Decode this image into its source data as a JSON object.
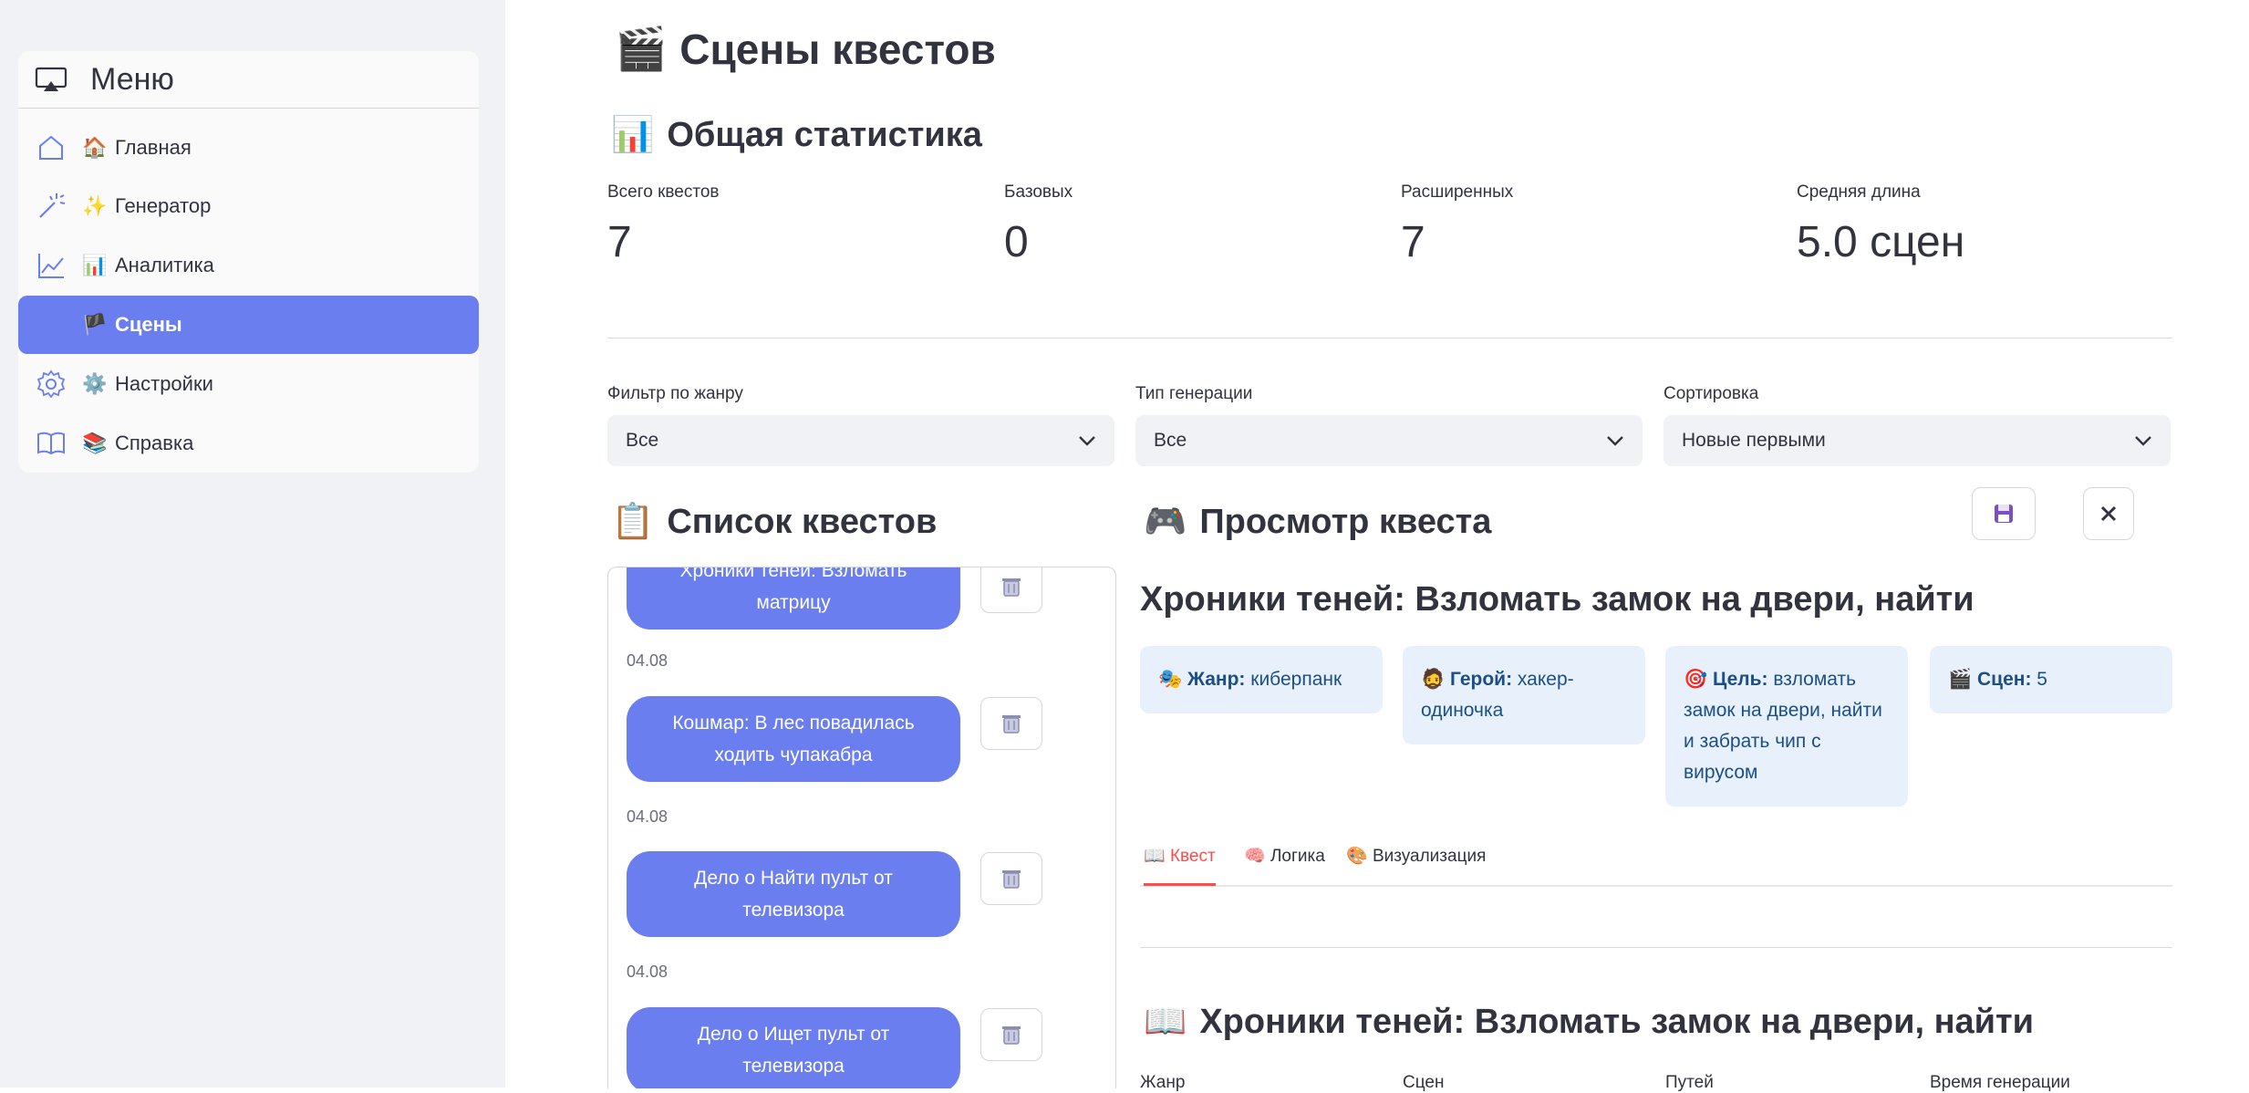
{
  "sidebar": {
    "title": "Меню",
    "items": [
      {
        "emoji": "🏠",
        "label": "Главная"
      },
      {
        "emoji": "✨",
        "label": "Генератор"
      },
      {
        "emoji": "📊",
        "label": "Аналитика"
      },
      {
        "emoji": "🏴",
        "label": "Сцены"
      },
      {
        "emoji": "⚙️",
        "label": "Настройки"
      },
      {
        "emoji": "📚",
        "label": "Справка"
      }
    ],
    "active_item": "Сцены"
  },
  "page": {
    "title_emoji": "🎬",
    "title": "Сцены квестов"
  },
  "stats": {
    "heading_emoji": "📊",
    "heading": "Общая статистика",
    "metrics": [
      {
        "label": "Всего квестов",
        "value": "7"
      },
      {
        "label": "Базовых",
        "value": "0"
      },
      {
        "label": "Расширенных",
        "value": "7"
      },
      {
        "label": "Средняя длина",
        "value": "5.0 сцен"
      }
    ]
  },
  "filters": {
    "genre": {
      "label": "Фильтр по жанру",
      "value": "Все"
    },
    "gen_type": {
      "label": "Тип генерации",
      "value": "Все"
    },
    "sort": {
      "label": "Сортировка",
      "value": "Новые первыми"
    }
  },
  "quest_list": {
    "heading_emoji": "📋",
    "heading": "Список квестов",
    "items": [
      {
        "title": "Хроники теней: Взломать матрицу",
        "date": "04.08"
      },
      {
        "title": "Кошмар: В лес повадилась ходить чупакабра",
        "date": "04.08"
      },
      {
        "title": "Дело о Найти пульт от телевизора",
        "date": "04.08"
      },
      {
        "title": "Дело о Ищет пульт от телевизора",
        "date": "04.08"
      }
    ]
  },
  "viewer": {
    "heading_emoji": "🎮",
    "heading": "Просмотр квеста",
    "quest_title": "Хроники теней: Взломать замок на двери, найти",
    "info": {
      "genre": {
        "emoji": "🎭",
        "label": "Жанр:",
        "value": "киберпанк"
      },
      "hero": {
        "emoji": "🧔",
        "label": "Герой:",
        "value": "хакер-одиночка"
      },
      "goal": {
        "emoji": "🎯",
        "label": "Цель:",
        "value": "взломать замок на двери, найти и забрать чип с вирусом"
      },
      "scenes": {
        "emoji": "🎬",
        "label": "Сцен:",
        "value": "5"
      }
    },
    "tabs": [
      {
        "emoji": "📖",
        "label": "Квест"
      },
      {
        "emoji": "🧠",
        "label": "Логика"
      },
      {
        "emoji": "🎨",
        "label": "Визуализация"
      }
    ],
    "active_tab": "Квест",
    "section_emoji": "📖",
    "section_title": "Хроники теней: Взломать замок на двери, найти",
    "table_headers": [
      "Жанр",
      "Сцен",
      "Путей",
      "Время генерации"
    ]
  },
  "colors": {
    "accent": "#6a7ef0",
    "sidebar_bg": "#f0f2f6",
    "info_bg": "#e8f1fb",
    "active_tab": "#ff4b4b"
  }
}
